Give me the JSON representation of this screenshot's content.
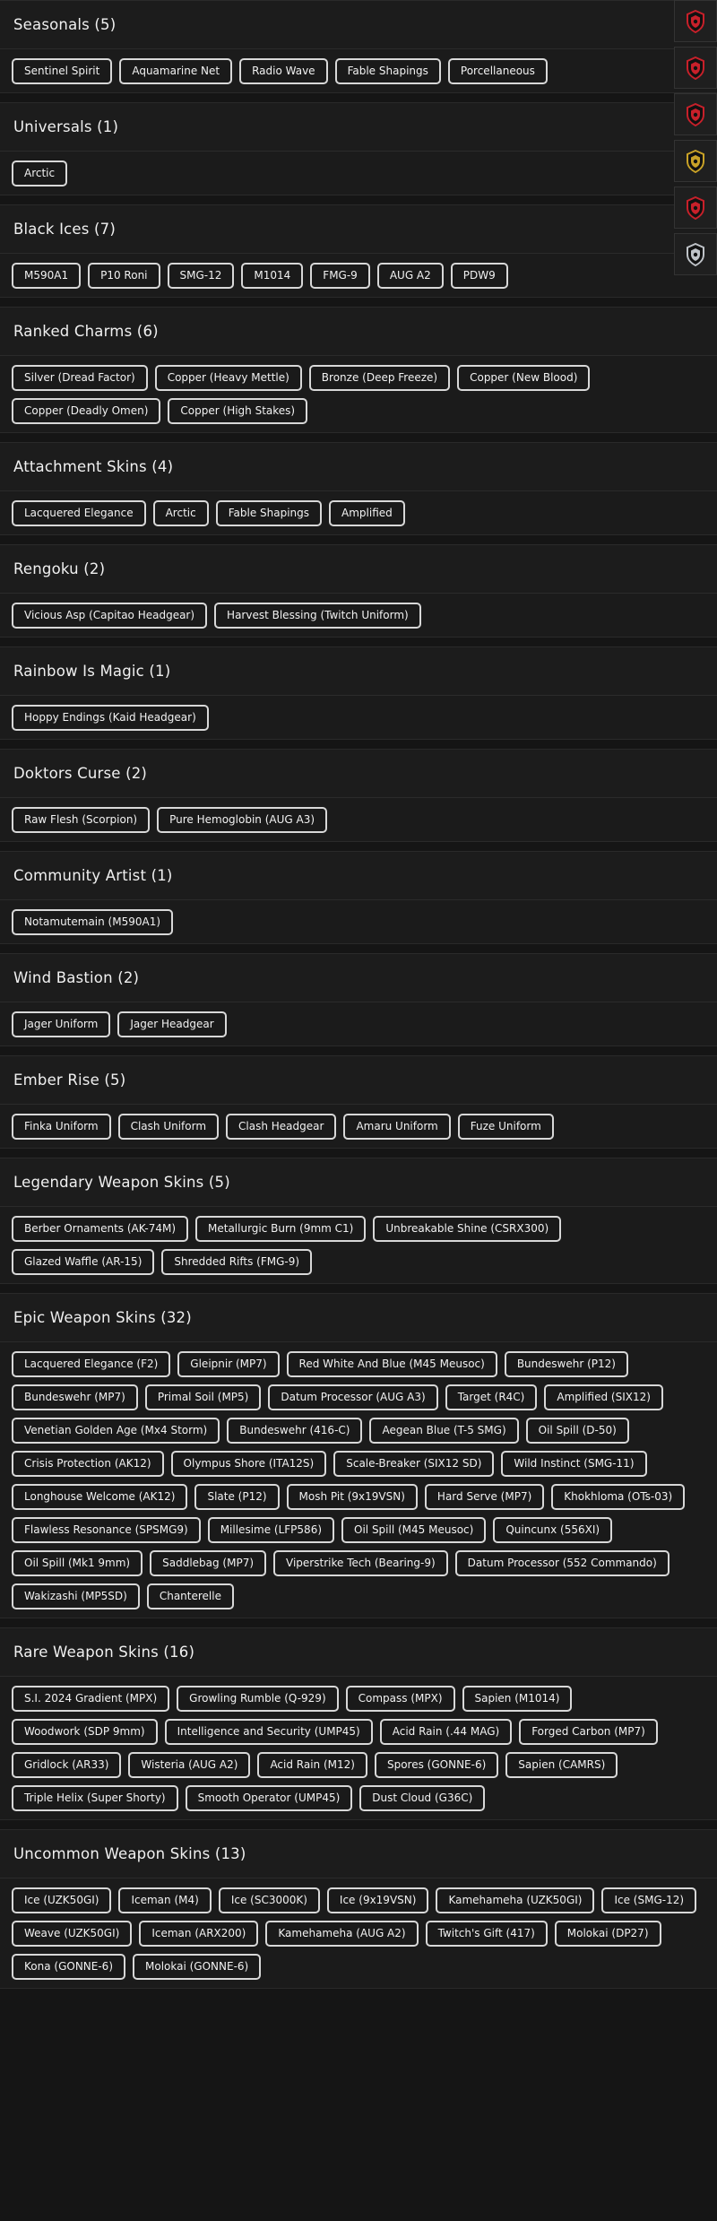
{
  "side_rail": [
    {
      "icon": "red-shield-badge-icon",
      "color": "#c8202a"
    },
    {
      "icon": "red-shield-badge-icon",
      "color": "#c8202a"
    },
    {
      "icon": "red-shield-badge-icon",
      "color": "#c8202a"
    },
    {
      "icon": "gold-shield-badge-icon",
      "color": "#c9a227"
    },
    {
      "icon": "red-shield-badge-icon",
      "color": "#c8202a"
    },
    {
      "icon": "silver-shield-badge-icon",
      "color": "#bfc3c8"
    }
  ],
  "sections": [
    {
      "title": "Seasonals (5)",
      "items": [
        "Sentinel Spirit",
        "Aquamarine Net",
        "Radio Wave",
        "Fable Shapings",
        "Porcellaneous"
      ]
    },
    {
      "title": "Universals (1)",
      "items": [
        "Arctic"
      ]
    },
    {
      "title": "Black Ices (7)",
      "items": [
        "M590A1",
        "P10 Roni",
        "SMG-12",
        "M1014",
        "FMG-9",
        "AUG A2",
        "PDW9"
      ]
    },
    {
      "title": "Ranked Charms (6)",
      "items": [
        "Silver (Dread Factor)",
        "Copper (Heavy Mettle)",
        "Bronze (Deep Freeze)",
        "Copper (New Blood)",
        "Copper (Deadly Omen)",
        "Copper (High Stakes)"
      ]
    },
    {
      "title": "Attachment Skins (4)",
      "items": [
        "Lacquered Elegance",
        "Arctic",
        "Fable Shapings",
        "Amplified"
      ]
    },
    {
      "title": "Rengoku (2)",
      "items": [
        "Vicious Asp (Capitao Headgear)",
        "Harvest Blessing (Twitch Uniform)"
      ]
    },
    {
      "title": "Rainbow Is Magic (1)",
      "items": [
        "Hoppy Endings (Kaid Headgear)"
      ]
    },
    {
      "title": "Doktors Curse (2)",
      "items": [
        "Raw Flesh (Scorpion)",
        "Pure Hemoglobin (AUG A3)"
      ]
    },
    {
      "title": "Community Artist (1)",
      "items": [
        "Notamutemain (M590A1)"
      ]
    },
    {
      "title": "Wind Bastion (2)",
      "items": [
        "Jager Uniform",
        "Jager Headgear"
      ]
    },
    {
      "title": "Ember Rise (5)",
      "items": [
        "Finka Uniform",
        "Clash Uniform",
        "Clash Headgear",
        "Amaru Uniform",
        "Fuze Uniform"
      ]
    },
    {
      "title": "Legendary Weapon Skins (5)",
      "items": [
        "Berber Ornaments (AK-74M)",
        "Metallurgic Burn (9mm C1)",
        "Unbreakable Shine (CSRX300)",
        "Glazed Waffle (AR-15)",
        "Shredded Rifts (FMG-9)"
      ]
    },
    {
      "title": "Epic Weapon Skins (32)",
      "items": [
        "Lacquered Elegance (F2)",
        "Gleipnir (MP7)",
        "Red White And Blue (M45 Meusoc)",
        "Bundeswehr (P12)",
        "Bundeswehr (MP7)",
        "Primal Soil (MP5)",
        "Datum Processor (AUG A3)",
        "Target (R4C)",
        "Amplified (SIX12)",
        "Venetian Golden Age (Mx4 Storm)",
        "Bundeswehr (416-C)",
        "Aegean Blue (T-5 SMG)",
        "Oil Spill (D-50)",
        "Crisis Protection (AK12)",
        "Olympus Shore (ITA12S)",
        "Scale-Breaker (SIX12 SD)",
        "Wild Instinct (SMG-11)",
        "Longhouse Welcome (AK12)",
        "Slate (P12)",
        "Mosh Pit (9x19VSN)",
        "Hard Serve (MP7)",
        "Khokhloma (OTs-03)",
        "Flawless Resonance (SPSMG9)",
        "Millesime (LFP586)",
        "Oil Spill (M45 Meusoc)",
        "Quincunx (556XI)",
        "Oil Spill (Mk1 9mm)",
        "Saddlebag (MP7)",
        "Viperstrike Tech (Bearing-9)",
        "Datum Processor (552 Commando)",
        "Wakizashi (MP5SD)",
        "Chanterelle"
      ]
    },
    {
      "title": "Rare Weapon Skins (16)",
      "items": [
        "S.I. 2024 Gradient (MPX)",
        "Growling Rumble (Q-929)",
        "Compass (MPX)",
        "Sapien (M1014)",
        "Woodwork (SDP 9mm)",
        "Intelligence and Security (UMP45)",
        "Acid Rain (.44 MAG)",
        "Forged Carbon (MP7)",
        "Gridlock (AR33)",
        "Wisteria (AUG A2)",
        "Acid Rain (M12)",
        "Spores (GONNE-6)",
        "Sapien (CAMRS)",
        "Triple Helix (Super Shorty)",
        "Smooth Operator (UMP45)",
        "Dust Cloud (G36C)"
      ]
    },
    {
      "title": "Uncommon Weapon Skins (13)",
      "items": [
        "Ice (UZK50GI)",
        "Iceman (M4)",
        "Ice (SC3000K)",
        "Ice (9x19VSN)",
        "Kamehameha (UZK50GI)",
        "Ice (SMG-12)",
        "Weave (UZK50GI)",
        "Iceman (ARX200)",
        "Kamehameha (AUG A2)",
        "Twitch's Gift (417)",
        "Molokai (DP27)",
        "Kona (GONNE-6)",
        "Molokai (GONNE-6)"
      ]
    }
  ]
}
